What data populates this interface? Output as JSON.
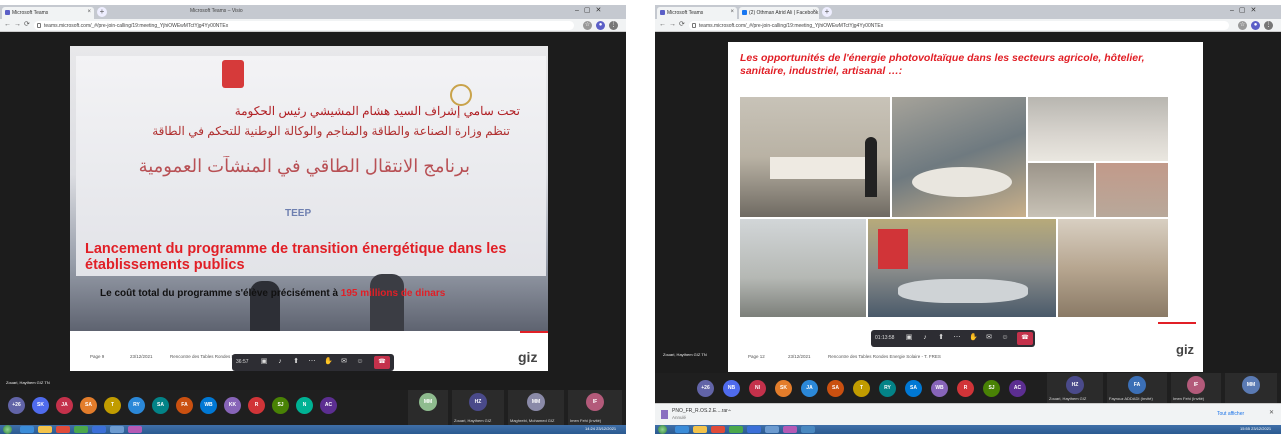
{
  "left": {
    "tabs": [
      {
        "label": "Microsoft Teams",
        "color": "#5b5fc7"
      },
      {
        "label": "Microsoft Teams – Visio",
        "color": "#5b5fc7"
      }
    ],
    "url": "teams.microsoft.com/_#/pre-join-calling/19:meeting_YjhiOWEwMTctYjg4Yy00NTEx",
    "slide": {
      "title_line1": "Lancement du programme de transition énergétique dans les",
      "title_line2": "établissements publics",
      "subtitle_prefix": "Le coût total du programme s'élève précisément à ",
      "subtitle_highlight": "195 millions de dinars",
      "arabic_line1": "تحت سامي إشراف السيد هشام المشيشي رئيس الحكومة",
      "arabic_line2": "تنظم وزارة الصناعة والطاقة والمناجم والوكالة الوطنية للتحكم في الطاقة",
      "arabic_line3": "برنامج الانتقال الطاقي في المنشآت العمومية",
      "teep": "TEEP",
      "footer_page": "Page 9",
      "footer_date": "23/12/2021",
      "footer_event": "Rencontre des Tables Rondes Energie Solaire - T. FRES",
      "logo": "giz",
      "toolbar_time": "36:57"
    },
    "presenter": "Zouari, Haythem GIZ TN",
    "avatars": [
      {
        "initials": "+26",
        "color": "#6264a7"
      },
      {
        "initials": "SK",
        "color": "#4f6bed"
      },
      {
        "initials": "JA",
        "color": "#c4314b"
      },
      {
        "initials": "SA",
        "color": "#e37d2b"
      },
      {
        "initials": "T",
        "color": "#c19c00"
      },
      {
        "initials": "RY",
        "color": "#2b88d8"
      },
      {
        "initials": "SA",
        "color": "#038387"
      },
      {
        "initials": "FA",
        "color": "#ca5010"
      },
      {
        "initials": "WB",
        "color": "#0078d4"
      },
      {
        "initials": "KK",
        "color": "#8764b8"
      },
      {
        "initials": "R",
        "color": "#d13438"
      },
      {
        "initials": "SJ",
        "color": "#498205"
      },
      {
        "initials": "N",
        "color": "#00b294"
      },
      {
        "initials": "AC",
        "color": "#5c2e91"
      }
    ],
    "tiles": [
      {
        "initials": "MM",
        "color": "#8fbc8f",
        "name": ""
      },
      {
        "initials": "HZ",
        "color": "#4a4a8a",
        "name": "Zouari, Haythem GIZ"
      },
      {
        "initials": "MM",
        "color": "#8a8aa8",
        "name": "Maghrebi, Mohamed GIZ"
      },
      {
        "initials": "IF",
        "color": "#b35a7a",
        "name": "Imen Fehi (Invité)"
      }
    ],
    "tray_time": "14:24",
    "tray_date": "23/12/2021"
  },
  "right": {
    "tabs": [
      {
        "label": "Microsoft Teams",
        "color": "#5b5fc7"
      },
      {
        "label": "(2) Othman Atrid Ali | Facebook",
        "color": "#1877f2"
      }
    ],
    "url": "teams.microsoft.com/_#/pre-join-calling/19:meeting_YjhiOWEwMTctYjg4Yy00NTEx",
    "slide": {
      "title": "Les opportunités de l'énergie photovoltaïque dans les secteurs agricole, hôtelier, sanitaire, industriel, artisanal …:",
      "footer_page": "Page 12",
      "footer_date": "23/12/2021",
      "footer_event": "Rencontre des Tables Rondes Energie Solaire - T. FRES",
      "logo": "giz",
      "toolbar_time": "01:13:58"
    },
    "presenter": "Zouari, Haythem GIZ TN",
    "avatars": [
      {
        "initials": "+26",
        "color": "#6264a7"
      },
      {
        "initials": "NB",
        "color": "#4f6bed"
      },
      {
        "initials": "NI",
        "color": "#c4314b"
      },
      {
        "initials": "SK",
        "color": "#e37d2b"
      },
      {
        "initials": "JA",
        "color": "#2b88d8"
      },
      {
        "initials": "SA",
        "color": "#ca5010"
      },
      {
        "initials": "T",
        "color": "#c19c00"
      },
      {
        "initials": "RY",
        "color": "#038387"
      },
      {
        "initials": "SA",
        "color": "#0078d4"
      },
      {
        "initials": "WB",
        "color": "#8764b8"
      },
      {
        "initials": "R",
        "color": "#d13438"
      },
      {
        "initials": "SJ",
        "color": "#498205"
      },
      {
        "initials": "AC",
        "color": "#5c2e91"
      }
    ],
    "tiles": [
      {
        "initials": "HZ",
        "color": "#4a4a8a",
        "name": "Zouari, Haythem GIZ"
      },
      {
        "initials": "FA",
        "color": "#3b6fb6",
        "name": "Fayrouz ADDADI (Invité)"
      },
      {
        "initials": "IF",
        "color": "#b35a7a",
        "name": "Imen Fehi (Invité)"
      },
      {
        "initials": "MM",
        "color": "#5a7ab3",
        "name": ""
      }
    ],
    "download_file": "PNO_FR_R.OS.2.E....rar",
    "download_sub": "Annulé",
    "show_all": "Tout afficher",
    "tray_time": "15:55",
    "tray_date": "23/12/2021"
  }
}
